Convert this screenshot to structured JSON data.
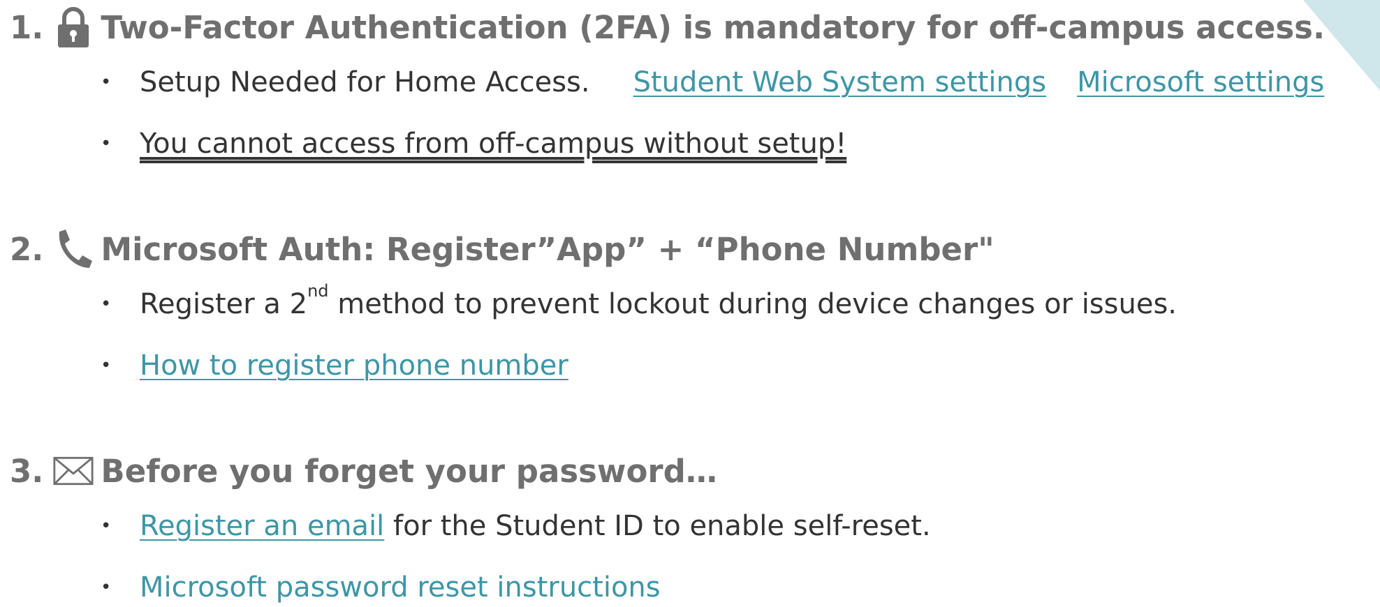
{
  "sections": [
    {
      "number": "1.",
      "icon": "lock-icon",
      "title": "Two-Factor Authentication (2FA) is mandatory for off-campus access.",
      "bullets": [
        {
          "text": "Setup Needed for Home Access.",
          "links": [
            "Student Web System settings",
            "Microsoft settings"
          ]
        },
        {
          "text": "You cannot access from off-campus without setup!"
        }
      ]
    },
    {
      "number": "2.",
      "icon": "phone-icon",
      "title": "Microsoft Auth: Register”App” + “Phone Number\"",
      "bullets": [
        {
          "text_before": "Register a 2",
          "superscript": "nd",
          "text_after": " method to prevent lockout during device changes or issues."
        },
        {
          "link": "How to register phone number"
        }
      ]
    },
    {
      "number": "3.",
      "icon": "envelope-icon",
      "title": "Before you forget your password…",
      "bullets": [
        {
          "link": "Register an email",
          "text_after": " for the Student ID to enable self-reset."
        },
        {
          "link": "Microsoft password reset instructions"
        }
      ]
    }
  ],
  "colors": {
    "heading": "#6f6f6f",
    "body_text": "#333333",
    "link": "#3d96a6",
    "corner_accent": "#cfe6ea"
  }
}
